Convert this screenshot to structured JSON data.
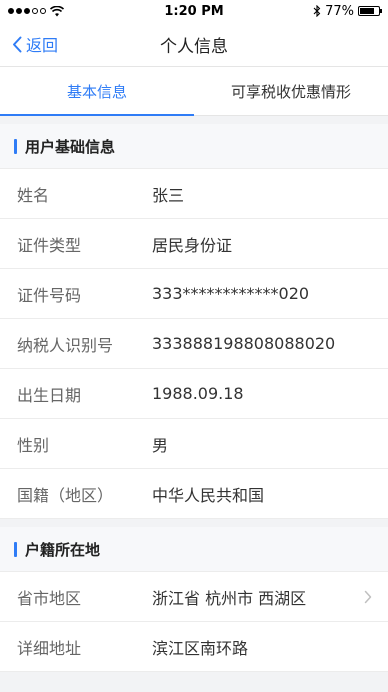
{
  "status": {
    "time": "1:20 PM",
    "battery": "77%",
    "battery_level": 0.77
  },
  "nav": {
    "back_label": "返回",
    "title": "个人信息"
  },
  "tabs": [
    {
      "label": "基本信息",
      "active": true
    },
    {
      "label": "可享税收优惠情形",
      "active": false
    }
  ],
  "sections": {
    "basic": {
      "title": "用户基础信息",
      "rows": [
        {
          "label": "姓名",
          "value": "张三"
        },
        {
          "label": "证件类型",
          "value": "居民身份证"
        },
        {
          "label": "证件号码",
          "value": "333************020"
        },
        {
          "label": "纳税人识别号",
          "value": "333888198808088020"
        },
        {
          "label": "出生日期",
          "value": "1988.09.18"
        },
        {
          "label": "性别",
          "value": "男"
        },
        {
          "label": "国籍（地区）",
          "value": "中华人民共和国"
        }
      ]
    },
    "household": {
      "title": "户籍所在地",
      "rows": [
        {
          "label": "省市地区",
          "value": "浙江省 杭州市 西湖区"
        },
        {
          "label": "详细地址",
          "value": "滨江区南环路"
        }
      ]
    }
  },
  "colors": {
    "accent": "#2f7cf6",
    "background": "#f2f3f5"
  },
  "icons": [
    "signal-dots-icon",
    "wifi-icon",
    "bluetooth-icon",
    "battery-icon",
    "chevron-left-icon",
    "chevron-right-icon"
  ]
}
